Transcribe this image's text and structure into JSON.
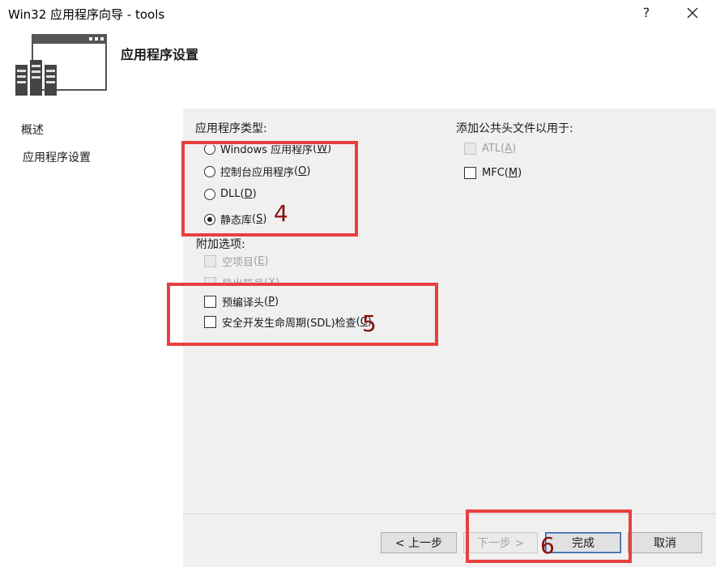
{
  "window": {
    "title": "Win32 应用程序向导 - tools",
    "help_label": "?"
  },
  "header": {
    "title": "应用程序设置",
    "logo_icon": "wizard-window-servers-icon"
  },
  "sidebar": {
    "items": [
      {
        "label": "概述"
      },
      {
        "label": "应用程序设置"
      }
    ]
  },
  "app_type": {
    "label": "应用程序类型:",
    "options": [
      {
        "label": "Windows 应用程序",
        "key": "W",
        "selected": false
      },
      {
        "label": "控制台应用程序",
        "key": "O",
        "selected": false
      },
      {
        "label": "DLL",
        "key": "D",
        "selected": false
      },
      {
        "label": "静态库",
        "key": "S",
        "selected": true
      }
    ]
  },
  "extra_options": {
    "label": "附加选项:",
    "options": [
      {
        "label": "空项目",
        "key": "E",
        "checked": false,
        "disabled": true
      },
      {
        "label": "导出符号",
        "key": "X",
        "checked": false,
        "disabled": true
      },
      {
        "label": "预编译头",
        "key": "P",
        "checked": false,
        "disabled": false
      },
      {
        "label": "安全开发生命周期(SDL)检查",
        "key": "C",
        "checked": false,
        "disabled": false
      }
    ]
  },
  "common_headers": {
    "label": "添加公共头文件以用于:",
    "options": [
      {
        "label": "ATL",
        "key": "A",
        "checked": false,
        "disabled": true
      },
      {
        "label": "MFC",
        "key": "M",
        "checked": false,
        "disabled": false
      }
    ]
  },
  "buttons": {
    "prev": "< 上一步",
    "next": "下一步 >",
    "finish": "完成",
    "cancel": "取消"
  },
  "annotations": {
    "n4": "4",
    "n5": "5",
    "n6": "6"
  },
  "colors": {
    "annotation_box": "#e8403f",
    "annotation_text": "#8a1010"
  }
}
